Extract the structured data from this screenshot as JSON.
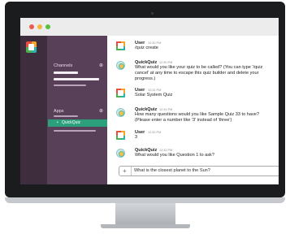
{
  "sidebar": {
    "channels_label": "Channels",
    "apps_label": "Apps",
    "active_app": "QuickQuiz",
    "plus": "⊕"
  },
  "messages": [
    {
      "sender": "User",
      "time": "12:30 PM",
      "text": "/quiz create",
      "avatar": "user"
    },
    {
      "sender": "QuickQuiz",
      "time": "12:30 PM",
      "text": "What would you like your quiz to be called? (You can type '/quiz cancel' at any time to escape this quiz builder and delete your progress.)",
      "avatar": "bot"
    },
    {
      "sender": "User",
      "time": "12:31 PM",
      "text": "Solar System Quiz",
      "avatar": "user"
    },
    {
      "sender": "QuickQuiz",
      "time": "12:31 PM",
      "text": "How many questions would you like Sample Quiz 33 to have? (Please enter a number like '3' instead of 'three')",
      "avatar": "bot"
    },
    {
      "sender": "User",
      "time": "12:32 PM",
      "text": "3",
      "avatar": "user"
    },
    {
      "sender": "QuickQuiz",
      "time": "12:32 PM",
      "text": "What would you like Question 1 to ask?",
      "avatar": "bot"
    }
  ],
  "composer": {
    "plus": "+",
    "value": "What is the closest planet to the Sun?"
  }
}
